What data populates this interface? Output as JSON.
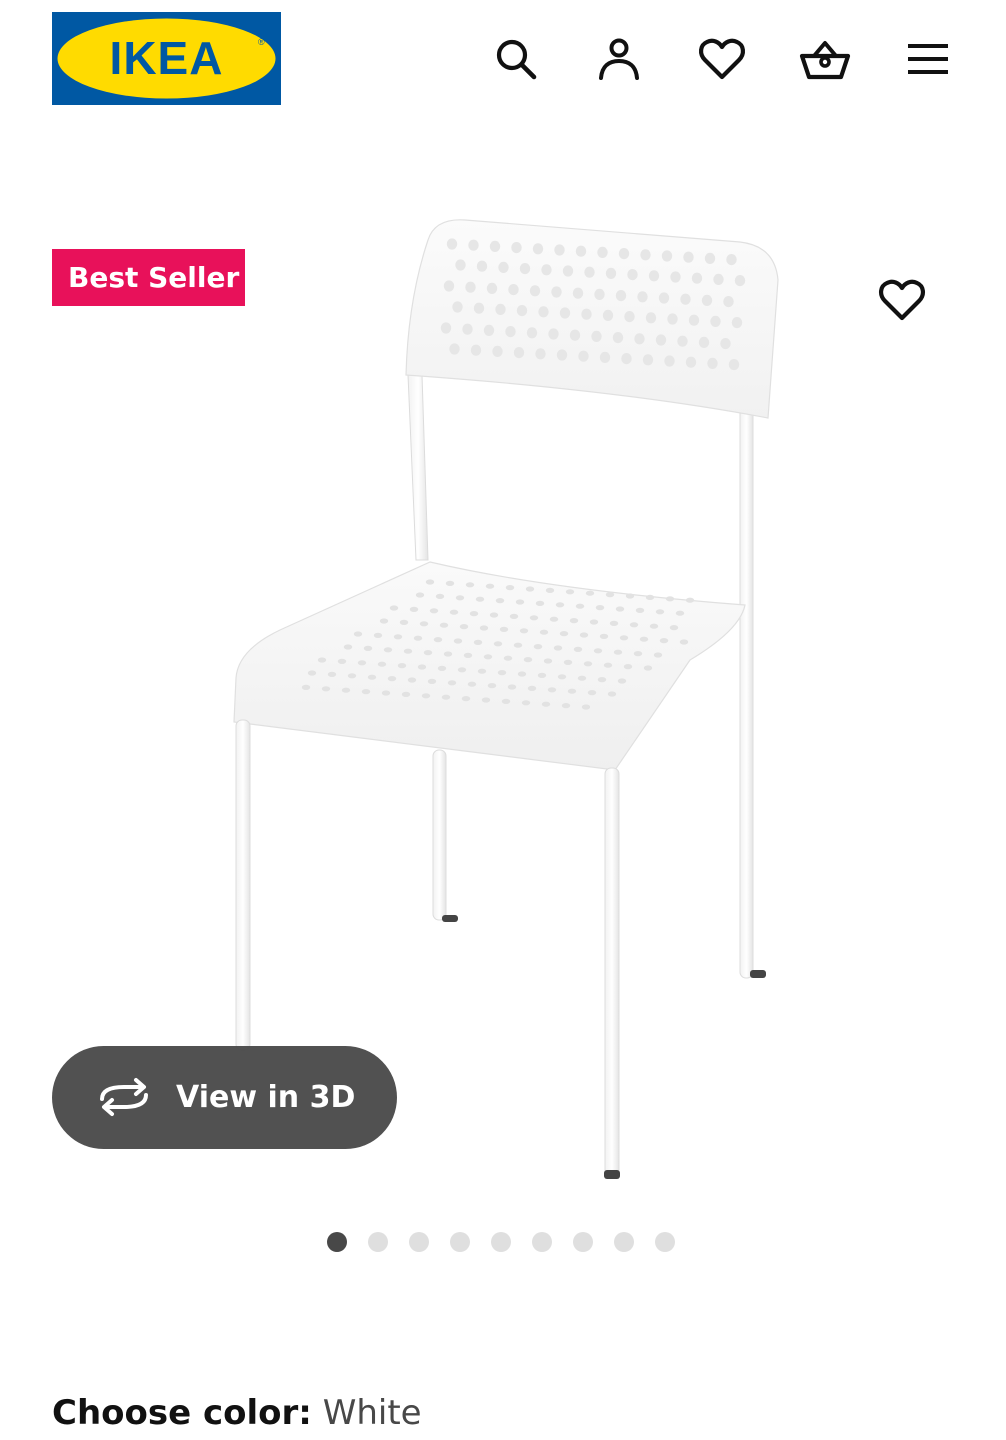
{
  "header": {
    "logo_text": "IKEA",
    "icons": [
      "search-icon",
      "account-icon",
      "heart-icon",
      "basket-icon",
      "menu-icon"
    ]
  },
  "product": {
    "badge": "Best Seller",
    "view_3d_label": "View in 3D",
    "carousel": {
      "count": 9,
      "active_index": 0
    },
    "color_label": "Choose color:",
    "color_value": "White"
  },
  "colors": {
    "ikea_blue": "#0058a3",
    "ikea_yellow": "#ffdb00",
    "badge_pink": "#e8115a",
    "view3d_bg": "#484848",
    "dot_active": "#484848",
    "dot_inactive": "#dfdfdf"
  }
}
